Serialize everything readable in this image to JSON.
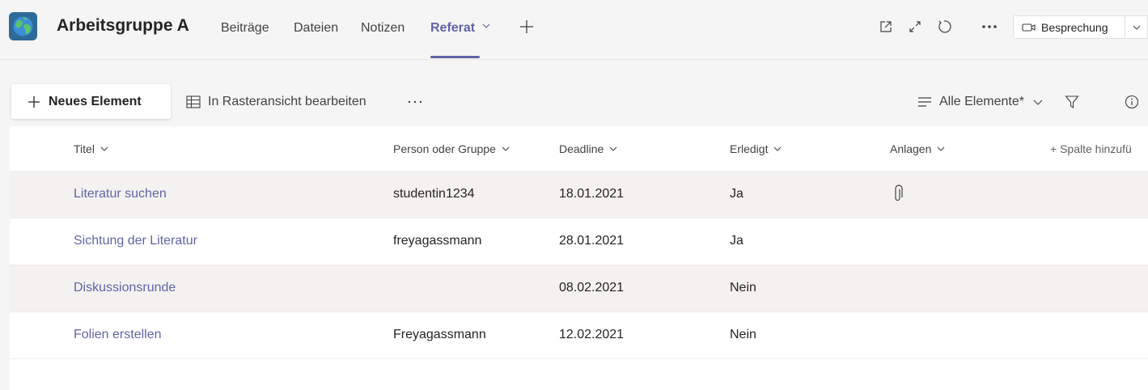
{
  "header": {
    "team_name": "Arbeitsgruppe A",
    "tabs": [
      {
        "label": "Beiträge"
      },
      {
        "label": "Dateien"
      },
      {
        "label": "Notizen"
      },
      {
        "label": "Referat",
        "active": true
      }
    ],
    "meeting_button": "Besprechung",
    "icons": [
      "globe-icon",
      "add-tab-icon",
      "popout-icon",
      "expand-icon",
      "refresh-icon",
      "more-icon",
      "video-icon",
      "chevron-down-icon"
    ],
    "accent_color": "#6264a7"
  },
  "commands": {
    "new_item": "Neues Element",
    "grid_edit": "In Rasteransicht bearbeiten",
    "view_name": "Alle Elemente*"
  },
  "list": {
    "columns": [
      {
        "label": "Titel"
      },
      {
        "label": "Person oder Gruppe"
      },
      {
        "label": "Deadline"
      },
      {
        "label": "Erledigt"
      },
      {
        "label": "Anlagen"
      }
    ],
    "add_column": "+ Spalte hinzufü",
    "rows": [
      {
        "title": "Literatur suchen",
        "person": "studentin1234",
        "deadline": "18.01.2021",
        "done": "Ja",
        "attachment": true
      },
      {
        "title": "Sichtung der Literatur",
        "person": "freyagassmann",
        "deadline": "28.01.2021",
        "done": "Ja",
        "attachment": false
      },
      {
        "title": "Diskussionsrunde",
        "person": "",
        "deadline": "08.02.2021",
        "done": "Nein",
        "attachment": false
      },
      {
        "title": "Folien erstellen",
        "person": "Freyagassmann",
        "deadline": "12.02.2021",
        "done": "Nein",
        "attachment": false
      }
    ]
  }
}
